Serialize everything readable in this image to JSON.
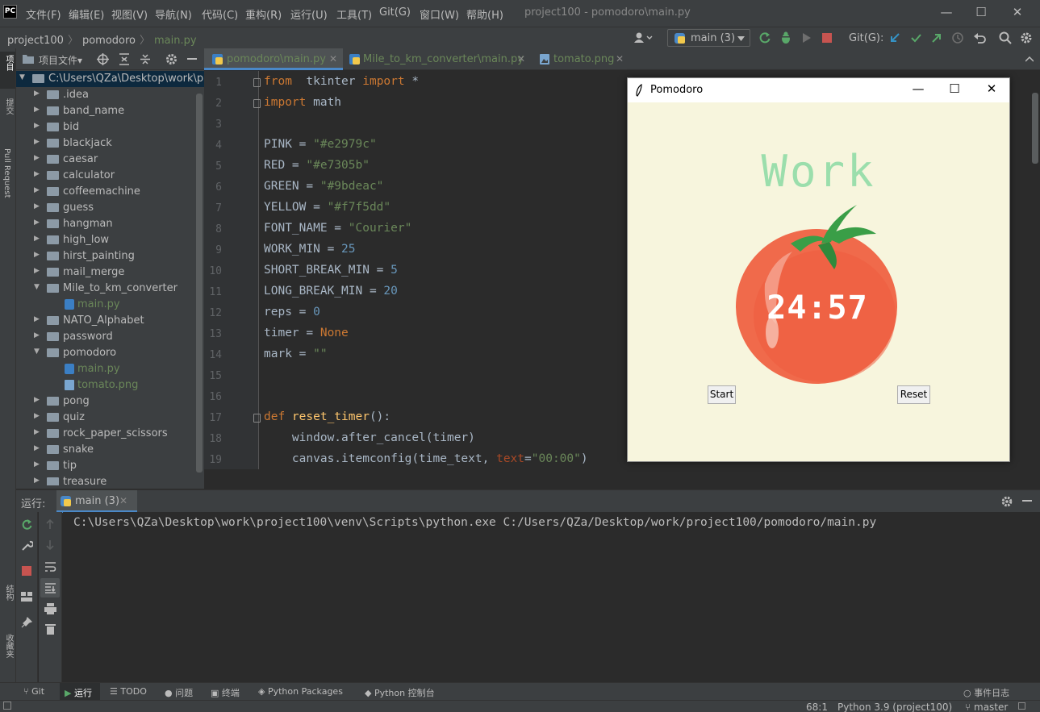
{
  "window": {
    "title": "project100 - pomodoro\\main.py",
    "logo": "PC",
    "controls": [
      "—",
      "☐",
      "✕"
    ]
  },
  "menu": [
    "文件(F)",
    "编辑(E)",
    "视图(V)",
    "导航(N)",
    "代码(C)",
    "重构(R)",
    "运行(U)",
    "工具(T)",
    "Git(G)",
    "窗口(W)",
    "帮助(H)"
  ],
  "breadcrumb": [
    "project100",
    "pomodoro",
    "main.py"
  ],
  "toolbar": {
    "run_config": "main (3)",
    "git_label": "Git(G):",
    "colors": {
      "run": "#59a869",
      "stop": "#c75450",
      "git_update": "#3592c4",
      "git_commit": "#59a869",
      "git_push": "#59a869"
    }
  },
  "left_stripe": {
    "project": "项目",
    "commit": "提交",
    "pull_requests": "Pull Request",
    "structure": "结构",
    "favorites": "收藏夹"
  },
  "project_panel": {
    "title": "项目文件▾",
    "root": "C:\\Users\\QZa\\Desktop\\work\\p",
    "items": [
      {
        "label": ".idea",
        "type": "folder",
        "expanded": false,
        "level": 1
      },
      {
        "label": "band_name",
        "type": "folder",
        "expanded": false,
        "level": 1
      },
      {
        "label": "bid",
        "type": "folder",
        "expanded": false,
        "level": 1
      },
      {
        "label": "blackjack",
        "type": "folder",
        "expanded": false,
        "level": 1
      },
      {
        "label": "caesar",
        "type": "folder",
        "expanded": false,
        "level": 1
      },
      {
        "label": "calculator",
        "type": "folder",
        "expanded": false,
        "level": 1
      },
      {
        "label": "coffeemachine",
        "type": "folder",
        "expanded": false,
        "level": 1
      },
      {
        "label": "guess",
        "type": "folder",
        "expanded": false,
        "level": 1
      },
      {
        "label": "hangman",
        "type": "folder",
        "expanded": false,
        "level": 1
      },
      {
        "label": "high_low",
        "type": "folder",
        "expanded": false,
        "level": 1
      },
      {
        "label": "hirst_painting",
        "type": "folder",
        "expanded": false,
        "level": 1
      },
      {
        "label": "mail_merge",
        "type": "folder",
        "expanded": false,
        "level": 1
      },
      {
        "label": "Mile_to_km_converter",
        "type": "folder",
        "expanded": true,
        "level": 1
      },
      {
        "label": "main.py",
        "type": "py",
        "level": 2
      },
      {
        "label": "NATO_Alphabet",
        "type": "folder",
        "expanded": false,
        "level": 1
      },
      {
        "label": "password",
        "type": "folder",
        "expanded": false,
        "level": 1
      },
      {
        "label": "pomodoro",
        "type": "folder",
        "expanded": true,
        "level": 1
      },
      {
        "label": "main.py",
        "type": "py",
        "level": 2
      },
      {
        "label": "tomato.png",
        "type": "img",
        "level": 2
      },
      {
        "label": "pong",
        "type": "folder",
        "expanded": false,
        "level": 1
      },
      {
        "label": "quiz",
        "type": "folder",
        "expanded": false,
        "level": 1
      },
      {
        "label": "rock_paper_scissors",
        "type": "folder",
        "expanded": false,
        "level": 1
      },
      {
        "label": "snake",
        "type": "folder",
        "expanded": false,
        "level": 1
      },
      {
        "label": "tip",
        "type": "folder",
        "expanded": false,
        "level": 1
      },
      {
        "label": "treasure",
        "type": "folder",
        "expanded": false,
        "level": 1
      }
    ]
  },
  "editor_tabs": [
    {
      "label": "pomodoro\\main.py",
      "active": true
    },
    {
      "label": "Mile_to_km_converter\\main.py",
      "active": false
    },
    {
      "label": "tomato.png",
      "active": false
    }
  ],
  "code_lines": [
    [
      [
        "kw",
        "from"
      ],
      [
        "",
        "  tkinter "
      ],
      [
        "kw",
        "import"
      ],
      [
        "",
        " *"
      ]
    ],
    [
      [
        "kw",
        "import"
      ],
      [
        "",
        " math"
      ]
    ],
    [],
    [
      [
        "",
        "PINK = "
      ],
      [
        "str",
        "\"#e2979c\""
      ]
    ],
    [
      [
        "",
        "RED = "
      ],
      [
        "str",
        "\"#e7305b\""
      ]
    ],
    [
      [
        "",
        "GREEN = "
      ],
      [
        "str",
        "\"#9bdeac\""
      ]
    ],
    [
      [
        "",
        "YELLOW = "
      ],
      [
        "str",
        "\"#f7f5dd\""
      ]
    ],
    [
      [
        "",
        "FONT_NAME = "
      ],
      [
        "str",
        "\"Courier\""
      ]
    ],
    [
      [
        "",
        "WORK_MIN = "
      ],
      [
        "num",
        "25"
      ]
    ],
    [
      [
        "",
        "SHORT_BREAK_MIN = "
      ],
      [
        "num",
        "5"
      ]
    ],
    [
      [
        "",
        "LONG_BREAK_MIN = "
      ],
      [
        "num",
        "20"
      ]
    ],
    [
      [
        "",
        "reps = "
      ],
      [
        "num",
        "0"
      ]
    ],
    [
      [
        "",
        "timer = "
      ],
      [
        "kw",
        "None"
      ]
    ],
    [
      [
        "",
        "mark = "
      ],
      [
        "str",
        "\"\""
      ]
    ],
    [],
    [],
    [
      [
        "kw",
        "def "
      ],
      [
        "fn",
        "reset_timer"
      ],
      [
        "",
        "():"
      ]
    ],
    [
      [
        "",
        "    window.after_cancel(timer)"
      ]
    ],
    [
      [
        "",
        "    canvas.itemconfig(time_text, "
      ],
      [
        "param",
        "text"
      ],
      [
        "",
        "="
      ],
      [
        "str",
        "\"00:00\""
      ],
      [
        "",
        ")"
      ]
    ]
  ],
  "pomodoro": {
    "title": "Pomodoro",
    "heading": "Work",
    "timer": "24:57",
    "start": "Start",
    "reset": "Reset",
    "colors": {
      "bg": "#f7f5dd",
      "heading": "#9bdeac",
      "tomato": "#f06a4b",
      "leaf": "#3a9e47"
    }
  },
  "run_panel": {
    "label": "运行:",
    "tab": "main (3)",
    "console": "C:\\Users\\QZa\\Desktop\\work\\project100\\venv\\Scripts\\python.exe C:/Users/QZa/Desktop/work/project100/pomodoro/main.py"
  },
  "bottom_tools": [
    "Git",
    "运行",
    "TODO",
    "问题",
    "终端",
    "Python Packages",
    "Python 控制台",
    "事件日志"
  ],
  "status": {
    "position": "68:1",
    "interpreter": "Python 3.9 (project100)",
    "branch": "master"
  }
}
